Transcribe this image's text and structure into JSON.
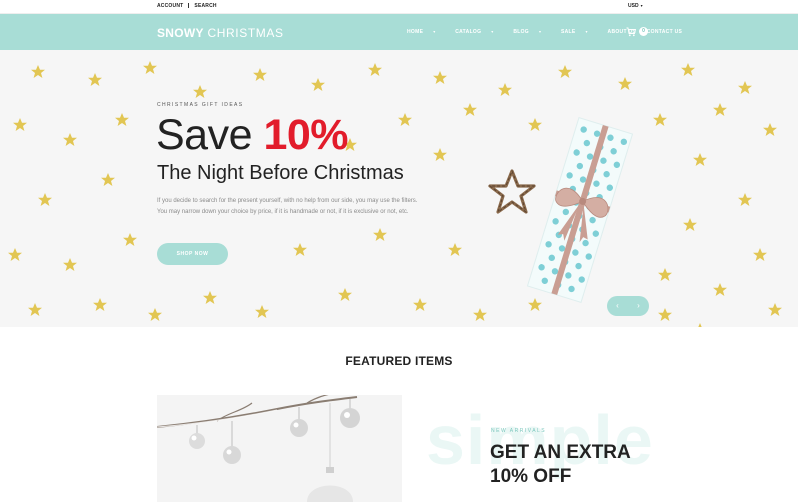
{
  "topbar": {
    "account": "ACCOUNT",
    "search": "SEARCH",
    "currency": "USD"
  },
  "header": {
    "logo_bold": "SNOWY",
    "logo_light": "CHRISTMAS",
    "nav": [
      {
        "label": "HOME",
        "dropdown": true
      },
      {
        "label": "CATALOG",
        "dropdown": true
      },
      {
        "label": "BLOG",
        "dropdown": true
      },
      {
        "label": "SALE",
        "dropdown": true
      },
      {
        "label": "ABOUT US",
        "dropdown": false
      },
      {
        "label": "CONTACT US",
        "dropdown": false
      }
    ],
    "cart_count": "0"
  },
  "hero": {
    "eyebrow": "CHRISTMAS GIFT IDEAS",
    "save_text": "Save",
    "save_percent": "10%",
    "subtitle": "The Night Before Christmas",
    "description": "If you decide to search for the present yourself, with no help from our side, you may use the filters. You may narrow down your choice by price, if it is handmade or not, if it is exclusive or not, etc.",
    "button": "SHOP NOW",
    "prev_arrow": "‹",
    "next_arrow": "›"
  },
  "featured": {
    "title": "FEATURED ITEMS",
    "promo_watermark": "simple",
    "promo_eyebrow": "NEW ARRIVALS",
    "promo_line1": "GET AN EXTRA",
    "promo_line2": "10% OFF"
  },
  "colors": {
    "accent": "#a8ddd6",
    "sale_red": "#e21c2b",
    "star_gold": "#e2c653",
    "gift_dot": "#7ecfd6",
    "ribbon": "#c99e93"
  },
  "icons": [
    "cart-icon",
    "chevron-down-icon",
    "arrow-left-icon",
    "arrow-right-icon"
  ]
}
